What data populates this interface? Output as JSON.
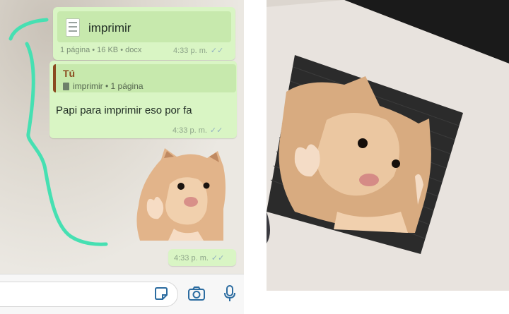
{
  "chat": {
    "document": {
      "name": "imprimir",
      "meta": "1 página • 16 KB • docx",
      "time": "4:33 p. m.",
      "icon": "document-icon"
    },
    "reply": {
      "quote_author": "Tú",
      "quote_text": "imprimir • 1 página",
      "text": "Papi para imprimir eso por fa",
      "time": "4:33 p. m."
    },
    "sticker": {
      "time": "4:33 p. m."
    },
    "input_bar": {
      "icons": [
        "sticker-icon",
        "camera-icon",
        "microphone-icon"
      ]
    }
  },
  "colors": {
    "bubble": "#d9f5c4",
    "quote_border": "#8a4a1f",
    "scribble": "#46e0b2",
    "ticks": "#92b1c1"
  }
}
